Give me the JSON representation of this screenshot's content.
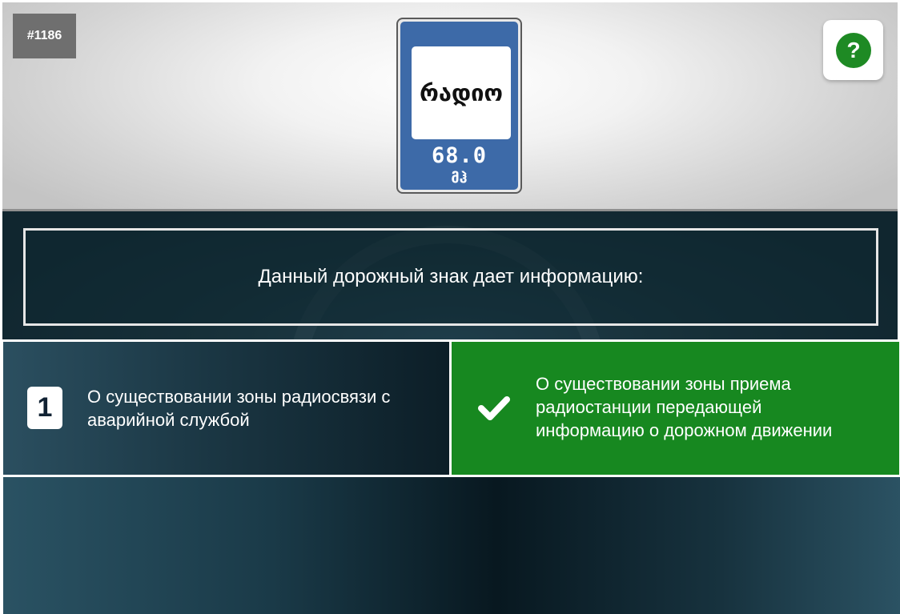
{
  "question_number": "#1186",
  "help_button": {
    "label": "?",
    "icon": "question-icon"
  },
  "sign": {
    "name_text": "რადიო",
    "frequency": "68.0",
    "unit": "მჰ",
    "colors": {
      "background": "#3d6aa8",
      "panel": "#ffffff"
    }
  },
  "question": {
    "text": "Данный дорожный знак дает информацию:"
  },
  "answers": [
    {
      "number": "1",
      "text": "О существовании зоны радиосвязи с аварийной службой",
      "state": "default"
    },
    {
      "icon": "checkmark-icon",
      "text": "О существовании зоны приема радиостанции передающей информацию о дорожном движении",
      "state": "correct"
    }
  ],
  "colors": {
    "correct": "#178820",
    "help_icon": "#1e8a24",
    "dark_bg": "#0c1e27"
  }
}
